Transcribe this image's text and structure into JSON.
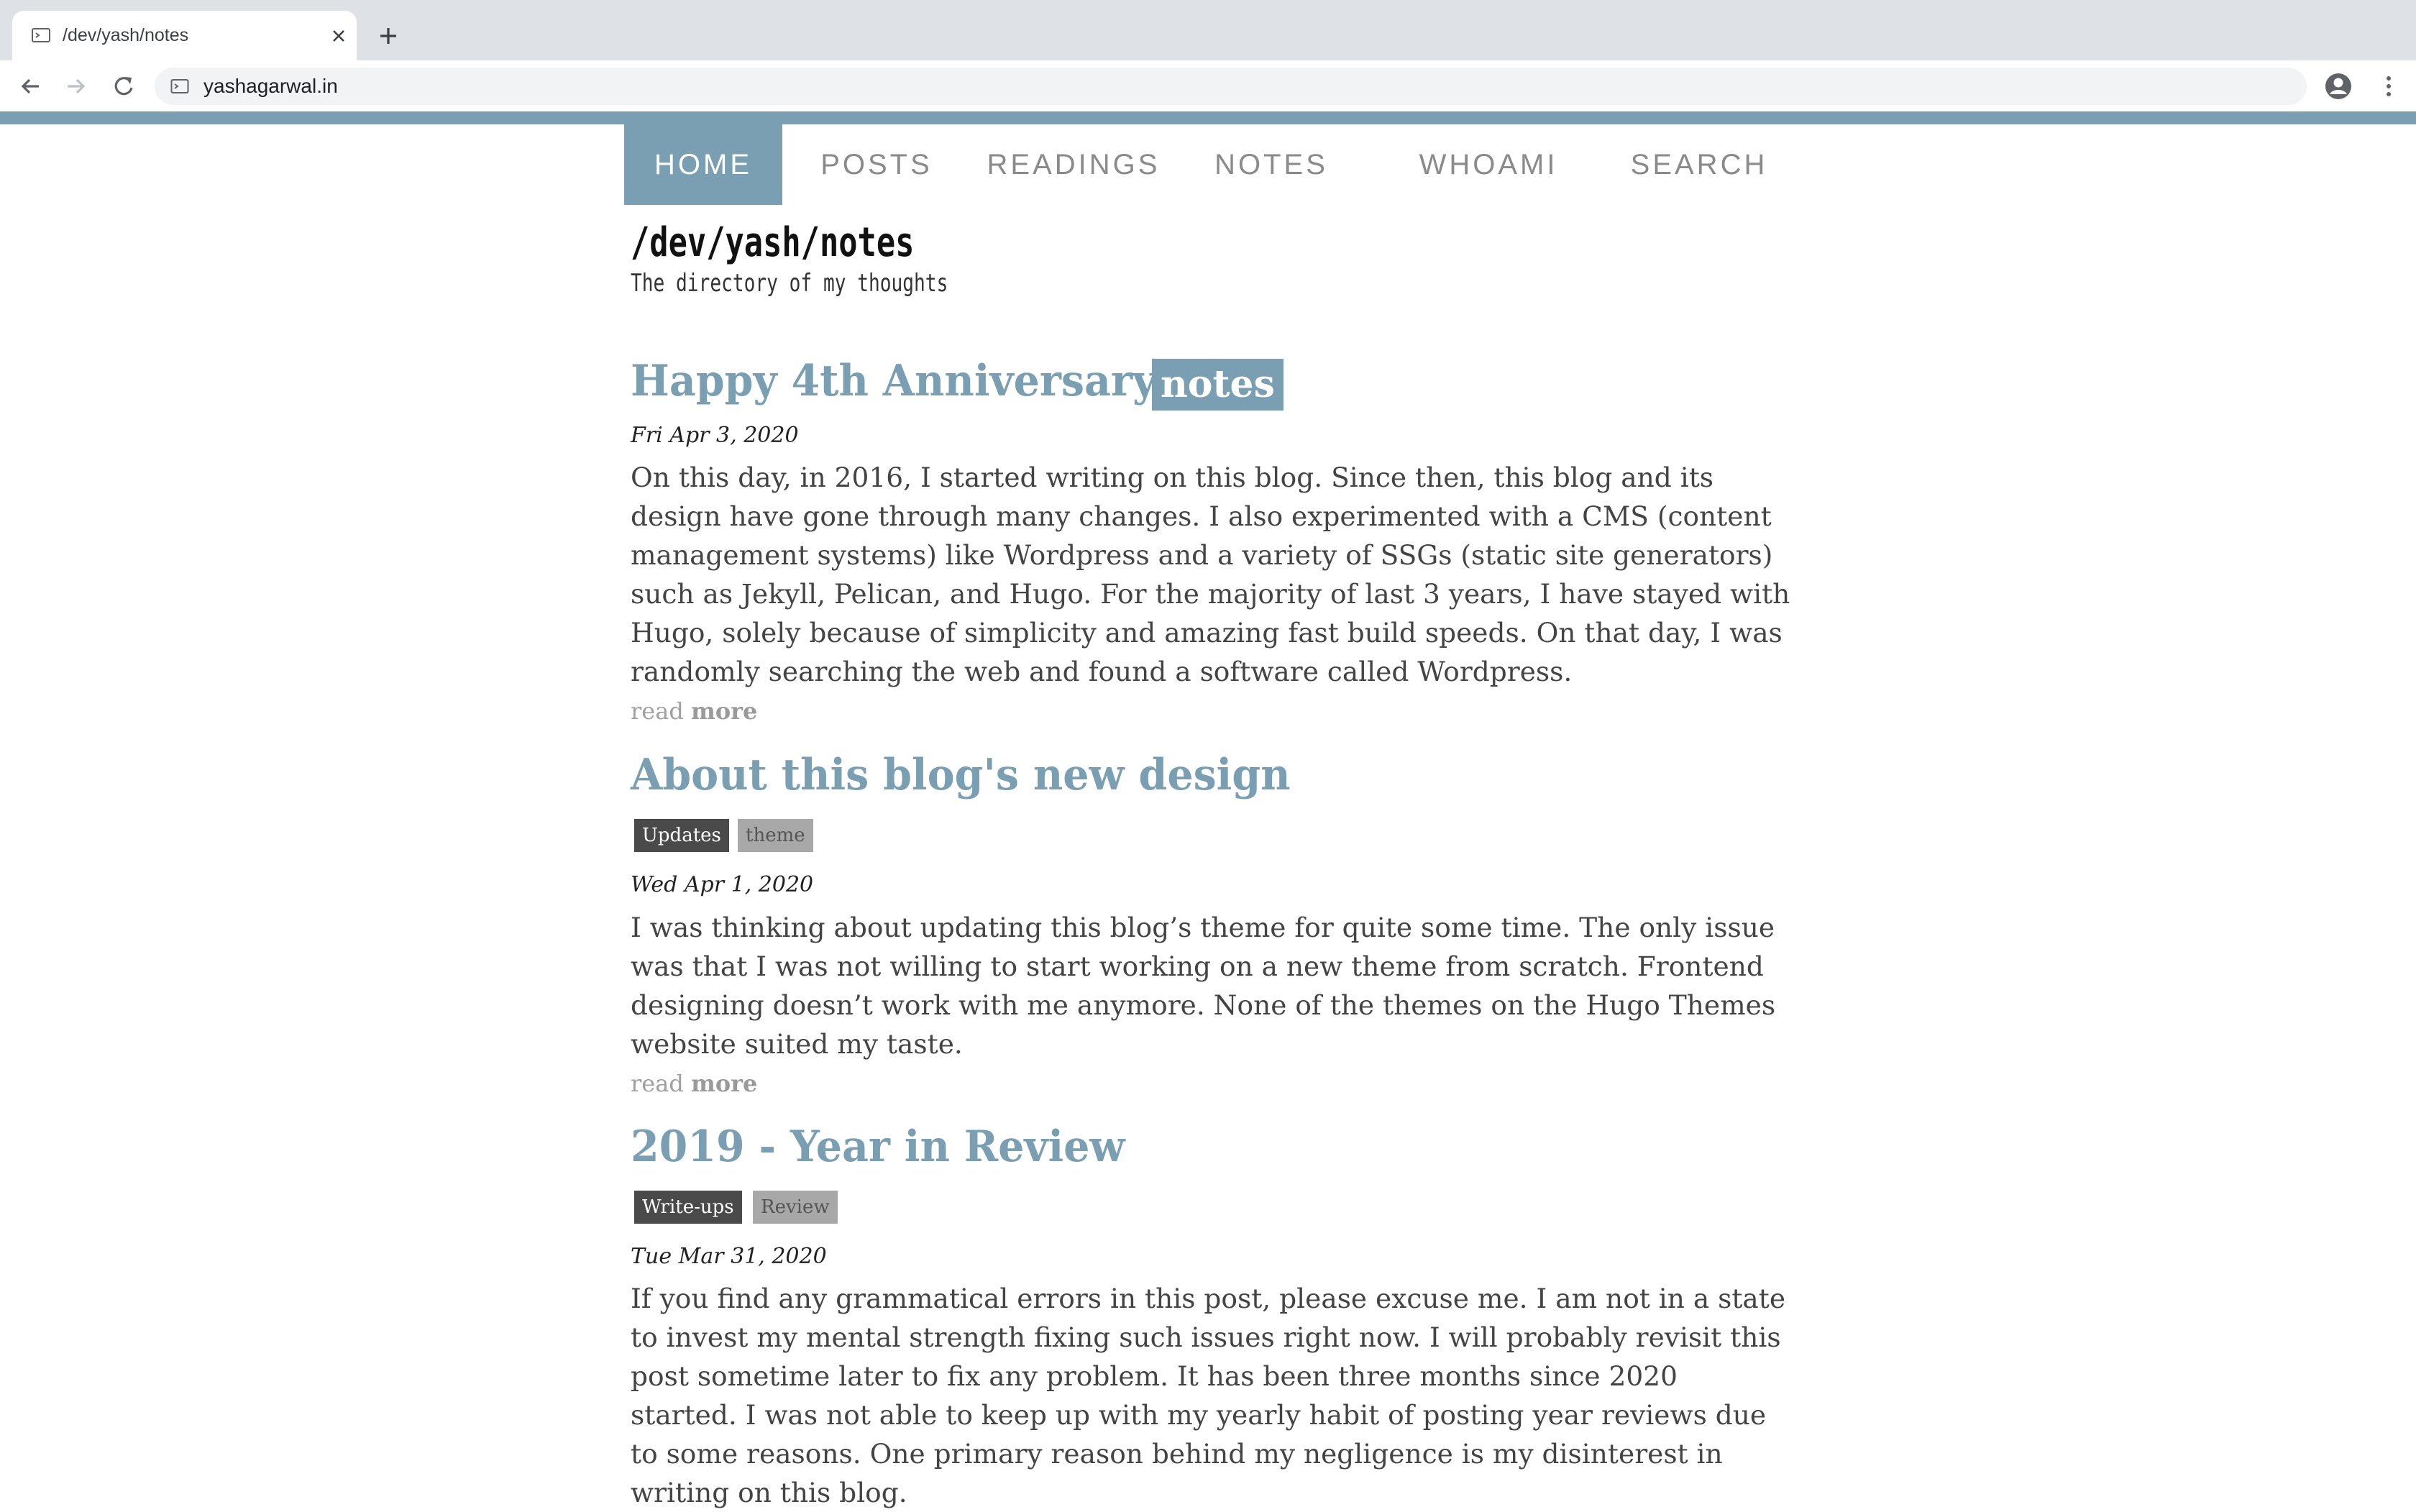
{
  "browser": {
    "tab_title": "/dev/yash/notes",
    "url": "yashagarwal.in",
    "accent_color": "#7a9fb3"
  },
  "nav": {
    "items": [
      {
        "label": "HOME",
        "active": true
      },
      {
        "label": "POSTS",
        "active": false
      },
      {
        "label": "READINGS",
        "active": false
      },
      {
        "label": "NOTES",
        "active": false
      },
      {
        "label": "WHOAMI",
        "active": false
      },
      {
        "label": "SEARCH",
        "active": false
      }
    ]
  },
  "header": {
    "title": "/dev/yash/notes",
    "subtitle": "The directory of my thoughts"
  },
  "posts": [
    {
      "title": "Happy 4th Anniversary!!",
      "category": "notes",
      "tags": [],
      "date": "Fri Apr 3, 2020",
      "excerpt": "On this day, in 2016, I started writing on this blog. Since then, this blog and its design have gone through many changes. I also experimented with a CMS (content management systems) like Wordpress and a variety of SSGs (static site generators) such as Jekyll, Pelican, and Hugo. For the majority of last 3 years, I have stayed with Hugo, solely because of simplicity and amazing fast build speeds. On that day, I was randomly searching the web and found a software called Wordpress.",
      "read_prefix": "read",
      "read_more": "more"
    },
    {
      "title": "About this blog's new design",
      "tags": [
        "Updates",
        "theme"
      ],
      "date": "Wed Apr 1, 2020",
      "excerpt": "I was thinking about updating this blog’s theme for quite some time. The only issue was that I was not willing to start working on a new theme from scratch. Frontend designing doesn’t work with me anymore. None of the themes on the Hugo Themes website suited my taste.",
      "read_prefix": "read",
      "read_more": "more"
    },
    {
      "title": "2019 - Year in Review",
      "tags": [
        "Write-ups",
        "Review"
      ],
      "date": "Tue Mar 31, 2020",
      "excerpt": "If you find any grammatical errors in this post, please excuse me. I am not in a state to invest my mental strength fixing such issues right now. I will probably revisit this post sometime later to fix any problem. It has been three months since 2020 started. I was not able to keep up with my yearly habit of posting year reviews due to some reasons. One primary reason behind my negligence is my disinterest in writing on this blog."
    }
  ]
}
